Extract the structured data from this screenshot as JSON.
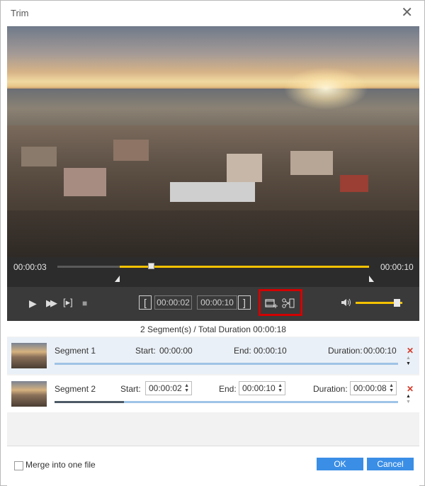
{
  "window": {
    "title": "Trim"
  },
  "player": {
    "current_time": "00:00:03",
    "total_time": "00:00:10",
    "playhead_fraction": 0.3,
    "selection_start_fraction": 0.2,
    "selection_end_fraction": 1.0,
    "volume_fraction": 0.9
  },
  "trim": {
    "start_time": "00:00:02",
    "end_time": "00:00:10"
  },
  "summary": {
    "text": "2 Segment(s) / Total Duration 00:00:18"
  },
  "segments": [
    {
      "name": "Segment 1",
      "start_label": "Start:",
      "start": "00:00:00",
      "end_label": "End:",
      "end": "00:00:10",
      "duration_label": "Duration:",
      "duration": "00:00:10"
    },
    {
      "name": "Segment 2",
      "start_label": "Start:",
      "start": "00:00:02",
      "end_label": "End:",
      "end": "00:00:10",
      "duration_label": "Duration:",
      "duration": "00:00:08"
    }
  ],
  "footer": {
    "merge_label": "Merge into one file",
    "ok_label": "OK",
    "cancel_label": "Cancel"
  },
  "colors": {
    "accent": "#f5c200",
    "button_blue": "#3a8ee6",
    "highlight_red": "#d20000",
    "delete_red": "#d63a2a"
  }
}
